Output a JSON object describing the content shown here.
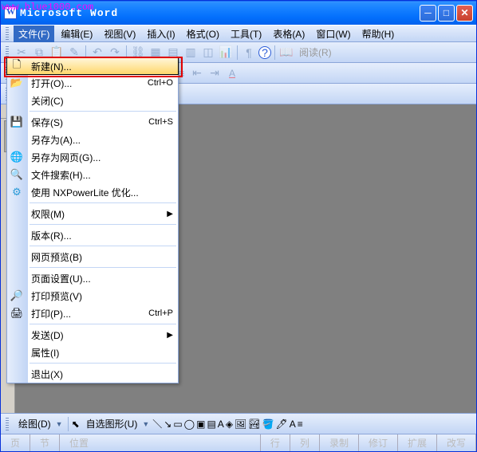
{
  "watermark": "www.blue1000.com",
  "title": "Microsoft Word",
  "menubar": [
    "文件(F)",
    "编辑(E)",
    "视图(V)",
    "插入(I)",
    "格式(O)",
    "工具(T)",
    "表格(A)",
    "窗口(W)",
    "帮助(H)"
  ],
  "toolbar2_read": "阅读(R)",
  "file_menu": {
    "new": "新建(N)...",
    "open": "打开(O)...",
    "open_sc": "Ctrl+O",
    "close": "关闭(C)",
    "save": "保存(S)",
    "save_sc": "Ctrl+S",
    "saveas": "另存为(A)...",
    "saveasweb": "另存为网页(G)...",
    "filesearch": "文件搜索(H)...",
    "nxpower": "使用 NXPowerLite 优化...",
    "perm": "权限(M)",
    "version": "版本(R)...",
    "webpreview": "网页预览(B)",
    "pagesetup": "页面设置(U)...",
    "printpreview": "打印预览(V)",
    "print": "打印(P)...",
    "print_sc": "Ctrl+P",
    "send": "发送(D)",
    "props": "属性(I)",
    "exit": "退出(X)"
  },
  "drawbar": {
    "draw": "绘图(D)",
    "autoshape": "自选图形(U)"
  },
  "status": {
    "page": "页",
    "sec": "节",
    "pos": "位置",
    "ln": "行",
    "col": "列",
    "rec": "录制",
    "rev": "修订",
    "ext": "扩展",
    "ovr": "改写"
  }
}
